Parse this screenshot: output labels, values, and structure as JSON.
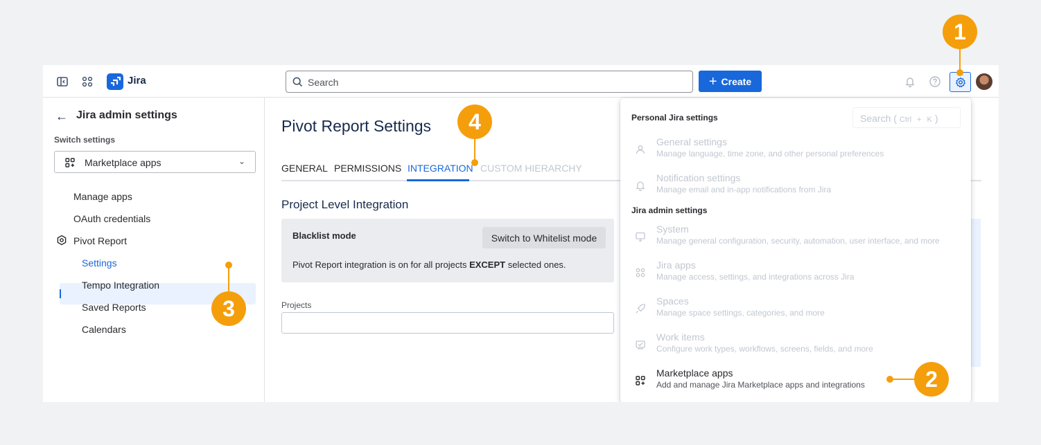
{
  "topbar": {
    "app_name": "Jira",
    "search_placeholder": "Search",
    "create_label": "Create"
  },
  "sidebar": {
    "title": "Jira admin settings",
    "switch_label": "Switch settings",
    "select_value": "Marketplace apps",
    "items": [
      {
        "label": "Manage apps"
      },
      {
        "label": "OAuth credentials"
      },
      {
        "label": "Pivot Report"
      },
      {
        "label": "Settings"
      },
      {
        "label": "Tempo Integration"
      },
      {
        "label": "Saved Reports"
      },
      {
        "label": "Calendars"
      }
    ]
  },
  "main": {
    "title": "Pivot Report Settings",
    "tabs": [
      {
        "label": "GENERAL"
      },
      {
        "label": "PERMISSIONS"
      },
      {
        "label": "INTEGRATION"
      },
      {
        "label": "CUSTOM HIERARCHY"
      }
    ],
    "section_title": "Project Level Integration",
    "mode_label": "Blacklist mode",
    "switch_button": "Switch to Whitelist mode",
    "desc_before": "Pivot Report integration is on for all projects ",
    "desc_bold": "EXCEPT",
    "desc_after": " selected ones.",
    "projects_label": "Projects"
  },
  "menu": {
    "personal_heading": "Personal Jira settings",
    "search_label": "Search (",
    "search_key1": "Ctrl",
    "search_plus": "+",
    "search_key2": "K",
    "search_close": ")",
    "admin_heading": "Jira admin settings",
    "personal_items": [
      {
        "title": "General settings",
        "desc": "Manage language, time zone, and other personal preferences"
      },
      {
        "title": "Notification settings",
        "desc": "Manage email and in-app notifications from Jira"
      }
    ],
    "admin_items": [
      {
        "title": "System",
        "desc": "Manage general configuration, security, automation, user interface, and more"
      },
      {
        "title": "Jira apps",
        "desc": "Manage access, settings, and integrations across Jira"
      },
      {
        "title": "Spaces",
        "desc": "Manage space settings, categories, and more"
      },
      {
        "title": "Work items",
        "desc": "Configure work types, workflows, screens, fields, and more"
      },
      {
        "title": "Marketplace apps",
        "desc": "Add and manage Jira Marketplace apps and integrations"
      }
    ]
  },
  "callouts": {
    "one": "1",
    "two": "2",
    "three": "3",
    "four": "4"
  },
  "colors": {
    "accent": "#1868db",
    "callout": "#f59e0b"
  }
}
